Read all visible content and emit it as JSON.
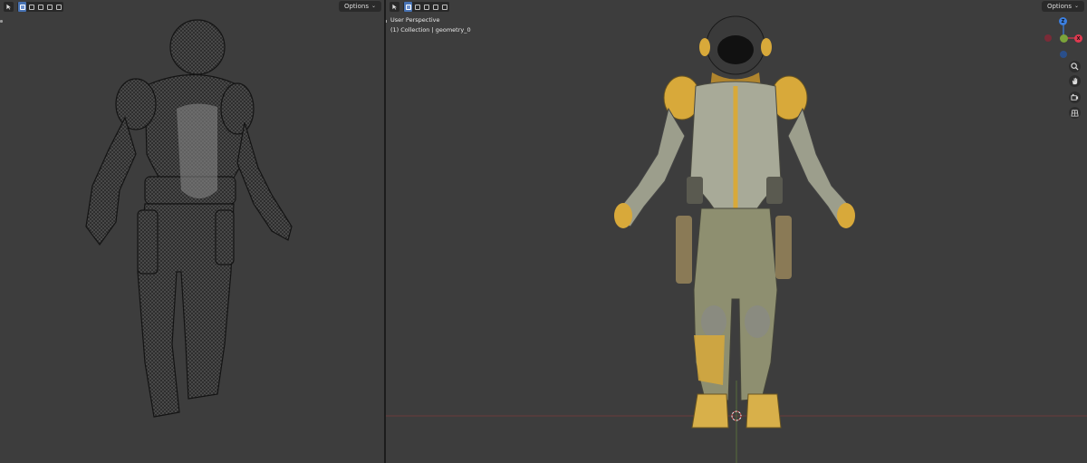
{
  "left_viewport": {
    "options_label": "Options"
  },
  "right_viewport": {
    "options_label": "Options",
    "view_name": "User Perspective",
    "collection_line": "(1) Collection | geometry_0"
  },
  "gizmo": {
    "axis_z_label": "Z",
    "axis_x_label": "X",
    "colors": {
      "x": "#e0394f",
      "y": "#7ba33a",
      "z": "#3b7fe0"
    }
  },
  "nav_icons": [
    "zoom-icon",
    "hand-pan-icon",
    "camera-icon",
    "grid-icon"
  ],
  "colors": {
    "viewport_bg": "#3d3d3d",
    "accent_blue": "#4772b3",
    "suit_yellow": "#d8a93a"
  }
}
